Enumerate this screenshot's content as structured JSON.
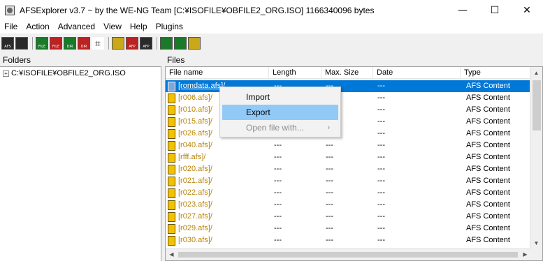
{
  "window": {
    "title": "AFSExplorer v3.7  ~ by the WE-NG Team [C:¥ISOFILE¥OBFILE2_ORG.ISO] 1166340096 bytes",
    "controls": {
      "minimize": "—",
      "maximize": "☐",
      "close": "✕"
    }
  },
  "menu": [
    "File",
    "Action",
    "Advanced",
    "View",
    "Help",
    "Plugins"
  ],
  "toolbar": {
    "buttons": [
      {
        "name": "afs-icon",
        "label": "AFS"
      },
      {
        "name": "save-icon",
        "label": ""
      },
      {
        "name": "file-icon",
        "label": "FILE"
      },
      {
        "name": "file-icon",
        "label": "FILE"
      },
      {
        "name": "dir-icon",
        "label": "DIR"
      },
      {
        "name": "dir-icon",
        "label": "DIR"
      },
      {
        "name": "binoculars-icon",
        "label": ""
      },
      {
        "name": "hammer-icon",
        "label": ""
      },
      {
        "name": "afp-icon",
        "label": "AFP"
      },
      {
        "name": "afp-icon",
        "label": "AFP"
      },
      {
        "name": "diamond-icon",
        "label": ""
      },
      {
        "name": "waveform-icon",
        "label": ""
      },
      {
        "name": "edit-icon",
        "label": ""
      }
    ]
  },
  "folders": {
    "label": "Folders",
    "root": "C:¥ISOFILE¥OBFILE2_ORG.ISO"
  },
  "files": {
    "label": "Files",
    "columns": [
      "File name",
      "Length",
      "Max. Size",
      "Date",
      "Type"
    ],
    "rows": [
      {
        "name": "[romdata.afs]/",
        "length": "---",
        "max": "---",
        "date": "---",
        "type": "AFS Content",
        "selected": true
      },
      {
        "name": "[r006.afs]/",
        "length": "---",
        "max": "---",
        "date": "---",
        "type": "AFS Content"
      },
      {
        "name": "[r010.afs]/",
        "length": "---",
        "max": "---",
        "date": "---",
        "type": "AFS Content"
      },
      {
        "name": "[r015.afs]/",
        "length": "---",
        "max": "---",
        "date": "---",
        "type": "AFS Content"
      },
      {
        "name": "[r026.afs]/",
        "length": "---",
        "max": "---",
        "date": "---",
        "type": "AFS Content"
      },
      {
        "name": "[r040.afs]/",
        "length": "---",
        "max": "---",
        "date": "---",
        "type": "AFS Content"
      },
      {
        "name": "[rfff.afs]/",
        "length": "---",
        "max": "---",
        "date": "---",
        "type": "AFS Content"
      },
      {
        "name": "[r020.afs]/",
        "length": "---",
        "max": "---",
        "date": "---",
        "type": "AFS Content"
      },
      {
        "name": "[r021.afs]/",
        "length": "---",
        "max": "---",
        "date": "---",
        "type": "AFS Content"
      },
      {
        "name": "[r022.afs]/",
        "length": "---",
        "max": "---",
        "date": "---",
        "type": "AFS Content"
      },
      {
        "name": "[r023.afs]/",
        "length": "---",
        "max": "---",
        "date": "---",
        "type": "AFS Content"
      },
      {
        "name": "[r027.afs]/",
        "length": "---",
        "max": "---",
        "date": "---",
        "type": "AFS Content"
      },
      {
        "name": "[r029.afs]/",
        "length": "---",
        "max": "---",
        "date": "---",
        "type": "AFS Content"
      },
      {
        "name": "[r030.afs]/",
        "length": "---",
        "max": "---",
        "date": "---",
        "type": "AFS Content"
      }
    ]
  },
  "context_menu": {
    "items": [
      {
        "label": "Import",
        "state": "normal"
      },
      {
        "label": "Export",
        "state": "highlighted"
      },
      {
        "label": "Open file with...",
        "state": "disabled",
        "submenu_arrow": "›"
      }
    ]
  },
  "colors": {
    "selection": "#0078d7",
    "menu_highlight": "#91c9f7",
    "name_text": "#b8860b"
  }
}
